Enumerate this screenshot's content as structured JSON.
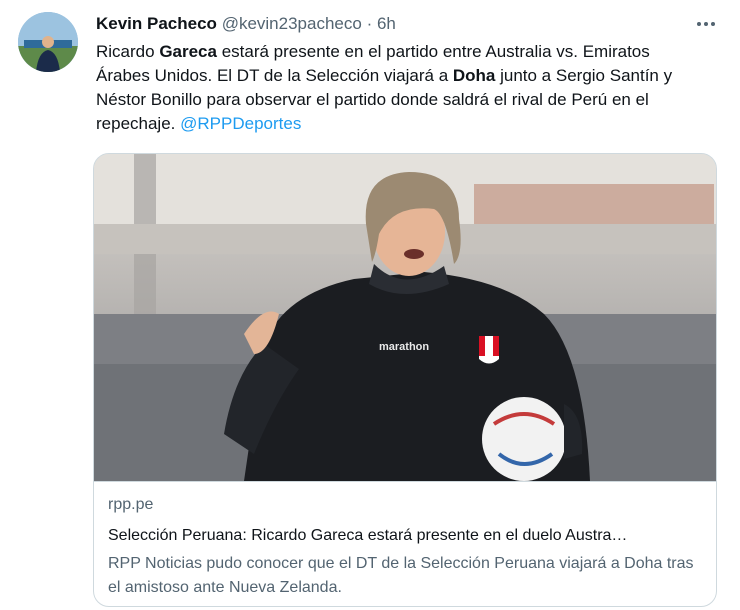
{
  "tweet": {
    "author_name": "Kevin Pacheco",
    "author_handle": "@kevin23pacheco",
    "separator": "·",
    "time": "6h",
    "text_parts": {
      "p1": "Ricardo ",
      "b1": "Gareca",
      "p2": " estará presente en el partido entre Australia vs. Emiratos Árabes Unidos. El DT de la Selección viajará a ",
      "b2": "Doha",
      "p3": " junto a Sergio Santín y Néstor Bonillo para observar el partido donde saldrá el rival de Perú en el repechaje. ",
      "mention": "@RPPDeportes"
    },
    "more_icon": "more-horizontal-icon"
  },
  "card": {
    "domain": "rpp.pe",
    "title": "Selección Peruana: Ricardo Gareca estará presente en el duelo Austra…",
    "description": "RPP Noticias pudo conocer que el DT de la Selección Peruana viajará a Doha tras el amistoso ante Nueva Zelanda.",
    "image_jacket_brand": "marathon"
  },
  "colors": {
    "link": "#1d9bf0",
    "text": "#0f1419",
    "secondary": "#536471",
    "border": "#cfd9de"
  }
}
